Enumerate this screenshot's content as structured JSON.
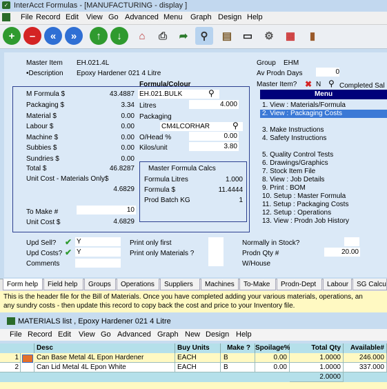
{
  "window": {
    "title": "InterAcct Formulas - [MANUFACTURING - display ]"
  },
  "menu": [
    "File",
    "Record",
    "Edit",
    "View",
    "Go",
    "Advanced",
    "Menu",
    "Graph",
    "Design",
    "Help"
  ],
  "toolbar": [
    "add",
    "delete",
    "first",
    "last",
    "down",
    "home",
    "print",
    "export",
    "search",
    "design",
    "screen",
    "settings",
    "calendar",
    "exit"
  ],
  "header": {
    "master_item_label": "Master Item",
    "master_item": "EH.021.4L",
    "description_label": "•Description",
    "description": "Epoxy Hardener 021 4 Litre",
    "group_label": "Group",
    "group": "EHM",
    "av_prodn_days_label": "Av Prodn Days",
    "av_prodn_days": "0",
    "master_item_q_label": "Master Item?",
    "master_item_q": "N",
    "completed_label": "Completed Sal"
  },
  "formula_colour_label": "Formula/Colour",
  "costs": {
    "m_formula_label": "M Formula $",
    "m_formula": "43.4887",
    "packaging_label": "Packaging $",
    "packaging": "3.34",
    "material_label": "Material $",
    "material": "0.00",
    "labour_label": "Labour  $",
    "labour": "0.00",
    "machine_label": "Machine  $",
    "machine": "0.00",
    "subbies_label": "Subbies  $",
    "subbies": "0.00",
    "sundries_label": "Sundries $",
    "sundries": "0.00",
    "total_label": "Total   $",
    "total": "46.8287",
    "unit_cost_materials_label": "Unit Cost - Materials Only$",
    "unit_cost_materials": "4.6829",
    "to_make_label": "To Make #",
    "to_make": "10",
    "unit_cost_label": "Unit Cost $",
    "unit_cost": "4.6829"
  },
  "formula": {
    "code": "EH.021.BULK",
    "litres_label": "Litres",
    "litres": "4.000",
    "packaging_label": "Packaging",
    "packaging_code": "CM4LCORHAR",
    "ohead_label": "O/Head %",
    "ohead": "0.00",
    "kilos_label": "Kilos/unit",
    "kilos": "3.80"
  },
  "master_calcs": {
    "title": "Master Formula Calcs",
    "litres_label": "Formula Litres",
    "litres": "1.000",
    "dollars_label": "Formula $",
    "dollars": "11.4444",
    "batch_label": "Prod Batch KG",
    "batch": "1"
  },
  "side_menu": {
    "title": "Menu",
    "items": [
      "1. View : Materials/Formula",
      "2. View : Packaging Costs",
      "",
      "3. Make Instructions",
      "4. Safety Instructions",
      "",
      "5. Quality Control Tests",
      "6. Drawings/Graphics",
      "7. Stock Item File",
      "8. View : Job Details",
      "9. Print : BOM",
      "10. Setup : Master Formula",
      "11. Setup : Packaging Costs",
      "12. Setup : Operations",
      "13. View : Prodn Job History"
    ],
    "selected": 1
  },
  "footer": {
    "upd_sell_label": "Upd Sell?",
    "upd_sell": "Y",
    "upd_costs_label": "Upd Costs?",
    "upd_costs": "Y",
    "comments_label": "Comments",
    "print_first_label": "Print only first",
    "print_materials_label": "Print only Materials ?",
    "normally_stock_label": "Normally in Stock?",
    "prodn_qty_label": "Prodn Qty #",
    "prodn_qty": "20.00",
    "warehouse_label": "W/House"
  },
  "tabs": [
    "Form help",
    "Field help",
    "Groups",
    "Operations",
    "Suppliers",
    "Machines",
    "To-Make",
    "Prodn-Dept",
    "Labour",
    "SG Calcul"
  ],
  "help_text": [
    "This is the header file for the Bill of Materials.  Once you have completed adding your various materials, operations, an",
    "any sundry costs - then update this record to copy back the cost and price to your Inventory file."
  ],
  "sub_window": {
    "title": "MATERIALS list , Epoxy Hardener 021 4 Litre",
    "menu": [
      "File",
      "Record",
      "Edit",
      "View",
      "Go",
      "Advanced",
      "Graph",
      "New",
      "Design",
      "Help"
    ],
    "columns": [
      "Desc",
      "Buy Units",
      "Make ?",
      "Spoilage%",
      "Total Qty",
      "Available#"
    ],
    "rows": [
      {
        "n": "1",
        "desc": "Can Base Metal 4L Epon Hardener",
        "units": "EACH",
        "make": "B",
        "spoil": "0.00",
        "qty": "1.0000",
        "avail": "246.000"
      },
      {
        "n": "2",
        "desc": "Can Lid Metal 4L Epon White",
        "units": "EACH",
        "make": "B",
        "spoil": "0.00",
        "qty": "1.0000",
        "avail": "337.000"
      }
    ],
    "total_qty": "2.0000"
  },
  "colors": {
    "window_bg": "#c7dcf0",
    "form_bg": "#dbe9f7",
    "menu_head": "#00007a",
    "selected": "#3b79d6",
    "help_bg": "#fff9c2",
    "grid_head": "#b5e0ea"
  }
}
